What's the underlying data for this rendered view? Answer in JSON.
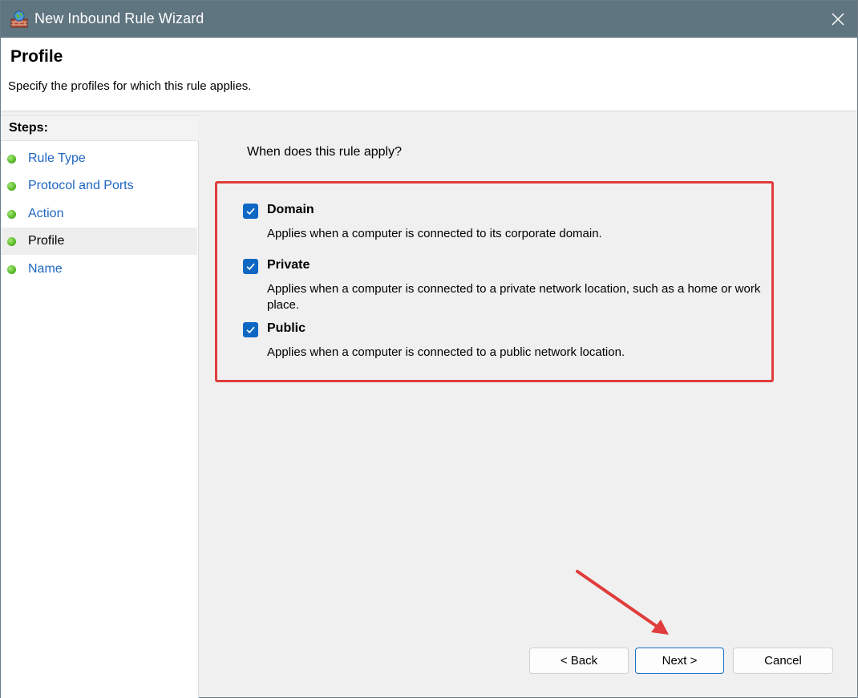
{
  "window": {
    "title": "New Inbound Rule Wizard",
    "icon": "firewall-icon"
  },
  "header": {
    "title": "Profile",
    "subtitle": "Specify the profiles for which this rule applies."
  },
  "steps": {
    "title": "Steps:",
    "items": [
      {
        "label": "Rule Type",
        "active": false
      },
      {
        "label": "Protocol and Ports",
        "active": false
      },
      {
        "label": "Action",
        "active": false
      },
      {
        "label": "Profile",
        "active": true
      },
      {
        "label": "Name",
        "active": false
      }
    ]
  },
  "content": {
    "question": "When does this rule apply?",
    "options": [
      {
        "label": "Domain",
        "checked": true,
        "description": "Applies when a computer is connected to its corporate domain."
      },
      {
        "label": "Private",
        "checked": true,
        "description": "Applies when a computer is connected to a private network location, such as a home or work place."
      },
      {
        "label": "Public",
        "checked": true,
        "description": "Applies when a computer is connected to a public network location."
      }
    ]
  },
  "buttons": {
    "back": "< Back",
    "next": "Next >",
    "cancel": "Cancel"
  },
  "colors": {
    "titlebar": "#5f7580",
    "accent": "#0f67c4",
    "annotation": "#e03c3c",
    "step_link": "#1f66c1"
  }
}
